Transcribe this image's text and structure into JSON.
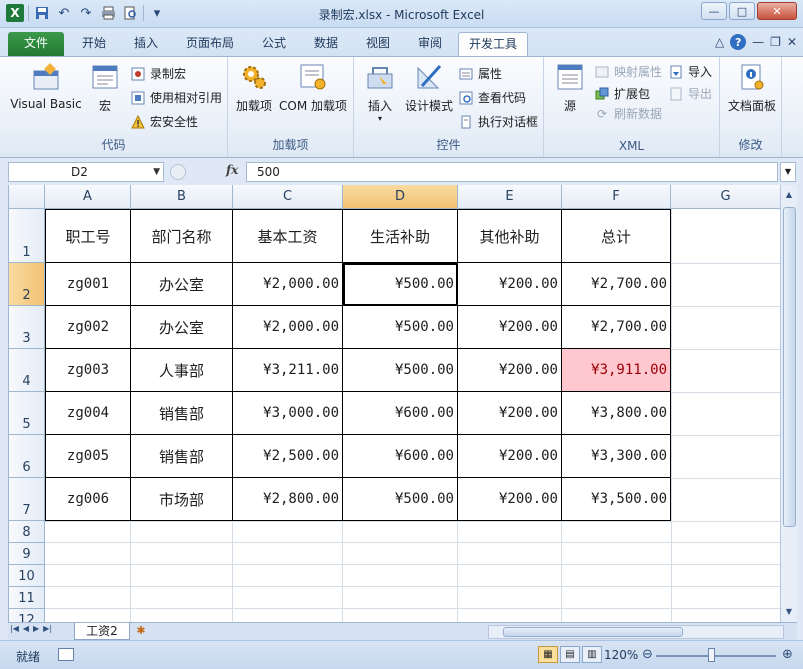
{
  "window": {
    "title": "录制宏.xlsx - Microsoft Excel",
    "controls": [
      "—",
      "□",
      "✕"
    ]
  },
  "qat": {
    "app_icon": "X",
    "icons": [
      "save-icon",
      "undo-icon",
      "redo-icon",
      "print-icon",
      "print-preview-icon",
      "customize-icon"
    ]
  },
  "tabs": [
    "文件",
    "开始",
    "插入",
    "页面布局",
    "公式",
    "数据",
    "视图",
    "审阅",
    "开发工具"
  ],
  "active_tab": "开发工具",
  "ribbon": {
    "code": {
      "label": "代码",
      "visual_basic": "Visual Basic",
      "macros": "宏",
      "record_macro": "录制宏",
      "relative_ref": "使用相对引用",
      "macro_security": "宏安全性"
    },
    "addins": {
      "label": "加载项",
      "addins": "加载项",
      "com_addins": "COM 加载项"
    },
    "controls": {
      "label": "控件",
      "insert": "插入",
      "design_mode": "设计模式",
      "properties": "属性",
      "view_code": "查看代码",
      "run_dialog": "执行对话框"
    },
    "xml": {
      "label": "XML",
      "source": "源",
      "map_properties": "映射属性",
      "expansion_packs": "扩展包",
      "refresh_data": "刷新数据",
      "import": "导入",
      "export": "导出"
    },
    "modify": {
      "label": "修改",
      "document_panel": "文档面板"
    }
  },
  "formula_bar": {
    "name_box": "D2",
    "fx": "fx",
    "value": "500"
  },
  "columns": [
    "A",
    "B",
    "C",
    "D",
    "E",
    "F",
    "G"
  ],
  "rows": [
    "1",
    "2",
    "3",
    "4",
    "5",
    "6",
    "7",
    "8",
    "9",
    "10",
    "11",
    "12"
  ],
  "table": {
    "headers": [
      "职工号",
      "部门名称",
      "基本工资",
      "生活补助",
      "其他补助",
      "总计"
    ],
    "rows": [
      [
        "zg001",
        "办公室",
        "¥2,000.00",
        "¥500.00",
        "¥200.00",
        "¥2,700.00"
      ],
      [
        "zg002",
        "办公室",
        "¥2,000.00",
        "¥500.00",
        "¥200.00",
        "¥2,700.00"
      ],
      [
        "zg003",
        "人事部",
        "¥3,211.00",
        "¥500.00",
        "¥200.00",
        "¥3,911.00"
      ],
      [
        "zg004",
        "销售部",
        "¥3,000.00",
        "¥600.00",
        "¥200.00",
        "¥3,800.00"
      ],
      [
        "zg005",
        "销售部",
        "¥2,500.00",
        "¥600.00",
        "¥200.00",
        "¥3,300.00"
      ],
      [
        "zg006",
        "市场部",
        "¥2,800.00",
        "¥500.00",
        "¥200.00",
        "¥3,500.00"
      ]
    ]
  },
  "sheet_tabs": [
    "工资2"
  ],
  "status": {
    "text": "就绪",
    "zoom": "120%"
  },
  "colors": {
    "highlight_fill": "#ffc7ce",
    "highlight_text": "#9c0006",
    "file_tab": "#217a31"
  }
}
